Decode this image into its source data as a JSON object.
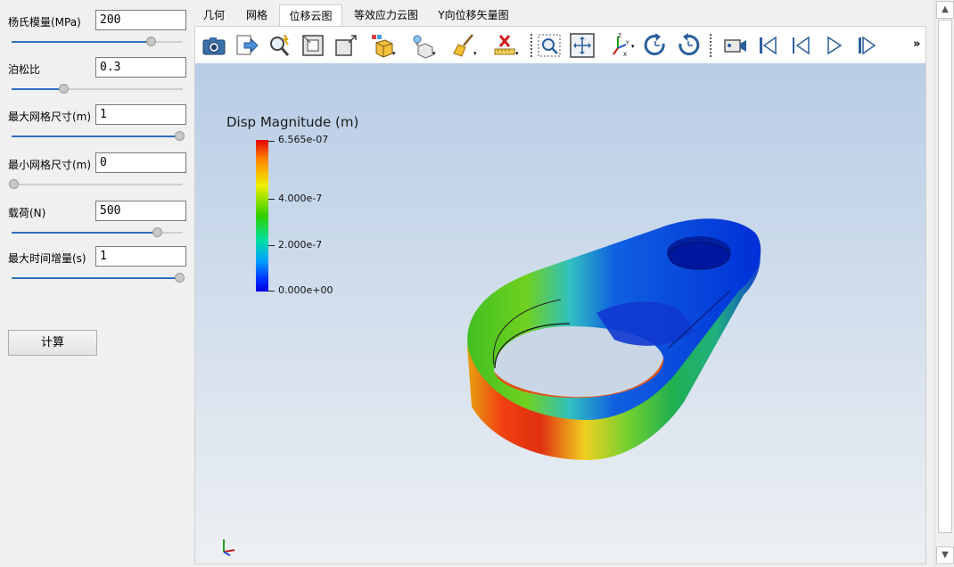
{
  "params": [
    {
      "label": "杨氏模量(MPa)",
      "value": "200",
      "slider": 0.81
    },
    {
      "label": "泊松比",
      "value": "0.3",
      "slider": 0.3
    },
    {
      "label": "最大网格尺寸(m)",
      "value": "1",
      "slider": 1.0
    },
    {
      "label": "最小网格尺寸(m)",
      "value": "0",
      "slider": 0.0
    },
    {
      "label": "载荷(N)",
      "value": "500",
      "slider": 0.85
    },
    {
      "label": "最大时间增量(s)",
      "value": "1",
      "slider": 1.0
    }
  ],
  "calc_button": "计算",
  "tabs": [
    "几何",
    "网格",
    "位移云图",
    "等效应力云图",
    "Y向位移矢量图"
  ],
  "active_tab": 2,
  "toolbar_icons": [
    "camera-icon",
    "export-icon",
    "zoom-magic-icon",
    "reset-view-icon",
    "fit-frame-icon",
    "cube-color-icon",
    "light-cube-icon",
    "broom-icon",
    "ruler-x-icon",
    "zoom-region-icon",
    "pan-move-icon",
    "axes-orientation-icon",
    "rotate-cw-icon",
    "rotate-ccw-icon",
    "camera-video-icon",
    "first-frame-icon",
    "previous-frame-icon",
    "play-icon",
    "next-frame-icon"
  ],
  "toolbar_more": "»",
  "legend": {
    "title": "Disp Magnitude (m)",
    "max_label": "6.565e-07",
    "ticks": [
      "4.000e-7",
      "2.000e-7",
      "0.000e+00"
    ]
  },
  "colors": {
    "accent": "#2e6fbf",
    "viewport_top": "#b8cde6",
    "viewport_bottom": "#edf0f3"
  }
}
